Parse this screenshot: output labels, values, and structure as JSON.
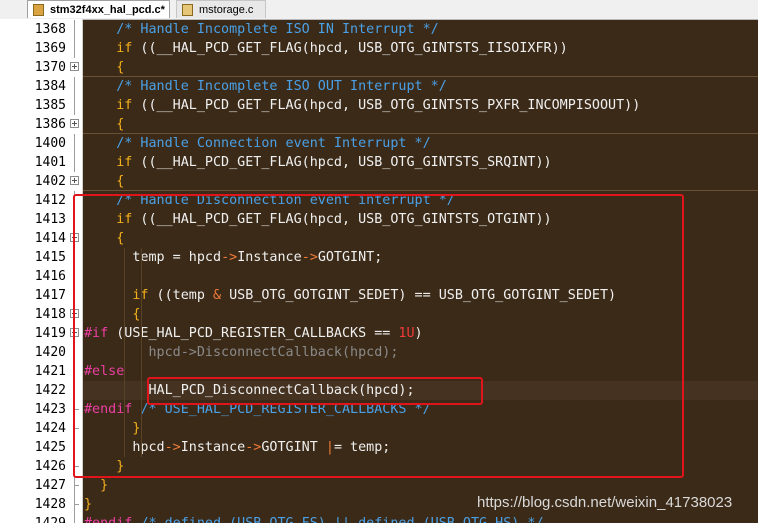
{
  "tabs": [
    {
      "label": "stm32f4xx_hal_pcd.c*",
      "active": true
    },
    {
      "label": "mstorage.c",
      "active": false
    }
  ],
  "colors": {
    "background": "#2b1d0e",
    "comment": "#4aa0e6",
    "keyword": "#f3b01c",
    "text": "#f0f0f0",
    "operator": "#f07c39",
    "preprocessor": "#ec3fa3",
    "number": "#ef3a3a",
    "inactive_code": "#8a8a8a",
    "highlight_border": "#e0141b"
  },
  "lines": [
    {
      "number": "1368",
      "fold": "line",
      "tokens": [
        {
          "t": "    "
        },
        {
          "t": "/* Handle Incomplete ISO IN Interrupt */",
          "c": "comment"
        }
      ]
    },
    {
      "number": "1369",
      "fold": "line",
      "tokens": [
        {
          "t": "    "
        },
        {
          "t": "if",
          "c": "keyword"
        },
        {
          "t": " ((__HAL_PCD_GET_FLAG(hpcd, USB_OTG_GINTSTS_IISOIXFR))"
        }
      ]
    },
    {
      "number": "1370",
      "fold": "plus",
      "tokens": [
        {
          "t": "    "
        },
        {
          "t": "{",
          "c": "keyword"
        }
      ]
    },
    {
      "number": "1384",
      "fold": "line",
      "tokens": [
        {
          "t": "    "
        },
        {
          "t": "/* Handle Incomplete ISO OUT Interrupt */",
          "c": "comment"
        }
      ]
    },
    {
      "number": "1385",
      "fold": "line",
      "tokens": [
        {
          "t": "    "
        },
        {
          "t": "if",
          "c": "keyword"
        },
        {
          "t": " ((__HAL_PCD_GET_FLAG(hpcd, USB_OTG_GINTSTS_PXFR_INCOMPISOOUT))"
        }
      ]
    },
    {
      "number": "1386",
      "fold": "plus",
      "tokens": [
        {
          "t": "    "
        },
        {
          "t": "{",
          "c": "keyword"
        }
      ]
    },
    {
      "number": "1400",
      "fold": "line",
      "tokens": [
        {
          "t": "    "
        },
        {
          "t": "/* Handle Connection event Interrupt */",
          "c": "comment"
        }
      ]
    },
    {
      "number": "1401",
      "fold": "line",
      "tokens": [
        {
          "t": "    "
        },
        {
          "t": "if",
          "c": "keyword"
        },
        {
          "t": " ((__HAL_PCD_GET_FLAG(hpcd, USB_OTG_GINTSTS_SRQINT))"
        }
      ]
    },
    {
      "number": "1402",
      "fold": "plus",
      "tokens": [
        {
          "t": "    "
        },
        {
          "t": "{",
          "c": "keyword"
        }
      ]
    },
    {
      "number": "1412",
      "fold": "line",
      "tokens": [
        {
          "t": "    "
        },
        {
          "t": "/* Handle Disconnection event interrupt */",
          "c": "comment"
        }
      ]
    },
    {
      "number": "1413",
      "fold": "line",
      "tokens": [
        {
          "t": "    "
        },
        {
          "t": "if",
          "c": "keyword"
        },
        {
          "t": " ((__HAL_PCD_GET_FLAG(hpcd, USB_OTG_GINTSTS_OTGINT))"
        }
      ]
    },
    {
      "number": "1414",
      "fold": "minus",
      "tokens": [
        {
          "t": "    "
        },
        {
          "t": "{",
          "c": "keyword"
        }
      ]
    },
    {
      "number": "1415",
      "fold": "line",
      "tokens": [
        {
          "t": "      temp = hpcd"
        },
        {
          "t": "->",
          "c": "operator"
        },
        {
          "t": "Instance"
        },
        {
          "t": "->",
          "c": "operator"
        },
        {
          "t": "GOTGINT;"
        }
      ]
    },
    {
      "number": "1416",
      "fold": "line",
      "tokens": []
    },
    {
      "number": "1417",
      "fold": "line",
      "tokens": [
        {
          "t": "      "
        },
        {
          "t": "if",
          "c": "keyword"
        },
        {
          "t": " ((temp "
        },
        {
          "t": "&",
          "c": "operator"
        },
        {
          "t": " USB_OTG_GOTGINT_SEDET) == USB_OTG_GOTGINT_SEDET)"
        }
      ]
    },
    {
      "number": "1418",
      "fold": "minus",
      "tokens": [
        {
          "t": "      "
        },
        {
          "t": "{",
          "c": "keyword"
        }
      ]
    },
    {
      "number": "1419",
      "fold": "minus",
      "tokens": [
        {
          "t": "#if",
          "c": "preprocessor"
        },
        {
          "t": " (USE_HAL_PCD_REGISTER_CALLBACKS == "
        },
        {
          "t": "1U",
          "c": "number"
        },
        {
          "t": ")"
        }
      ]
    },
    {
      "number": "1420",
      "fold": "line",
      "tokens": [
        {
          "t": "        hpcd->DisconnectCallback(hpcd);",
          "c": "inactive"
        }
      ]
    },
    {
      "number": "1421",
      "fold": "line",
      "tokens": [
        {
          "t": "#else",
          "c": "preprocessor"
        }
      ]
    },
    {
      "number": "1422",
      "fold": "line",
      "tokens": [
        {
          "t": "        HAL_PCD_DisconnectCallback(hpcd);"
        }
      ]
    },
    {
      "number": "1423",
      "fold": "end",
      "tokens": [
        {
          "t": "#endif",
          "c": "preprocessor"
        },
        {
          "t": " "
        },
        {
          "t": "/* USE_HAL_PCD_REGISTER_CALLBACKS */",
          "c": "comment"
        }
      ]
    },
    {
      "number": "1424",
      "fold": "end",
      "tokens": [
        {
          "t": "      "
        },
        {
          "t": "}",
          "c": "keyword"
        }
      ]
    },
    {
      "number": "1425",
      "fold": "line",
      "tokens": [
        {
          "t": "      hpcd"
        },
        {
          "t": "->",
          "c": "operator"
        },
        {
          "t": "Instance"
        },
        {
          "t": "->",
          "c": "operator"
        },
        {
          "t": "GOTGINT "
        },
        {
          "t": "|",
          "c": "operator"
        },
        {
          "t": "= temp;"
        }
      ]
    },
    {
      "number": "1426",
      "fold": "end",
      "tokens": [
        {
          "t": "    "
        },
        {
          "t": "}",
          "c": "keyword"
        }
      ]
    },
    {
      "number": "1427",
      "fold": "end",
      "tokens": [
        {
          "t": "  "
        },
        {
          "t": "}",
          "c": "keyword"
        }
      ]
    },
    {
      "number": "1428",
      "fold": "end",
      "tokens": [
        {
          "t": "}",
          "c": "keyword"
        }
      ]
    },
    {
      "number": "1429",
      "fold": "line",
      "tokens": [
        {
          "t": "#endif",
          "c": "preprocessor"
        },
        {
          "t": " "
        },
        {
          "t": "/* defined (USB_OTG_FS) || defined (USB_OTG_HS) */",
          "c": "comment"
        }
      ]
    }
  ],
  "watermark": "https://blog.csdn.net/weixin_41738023"
}
